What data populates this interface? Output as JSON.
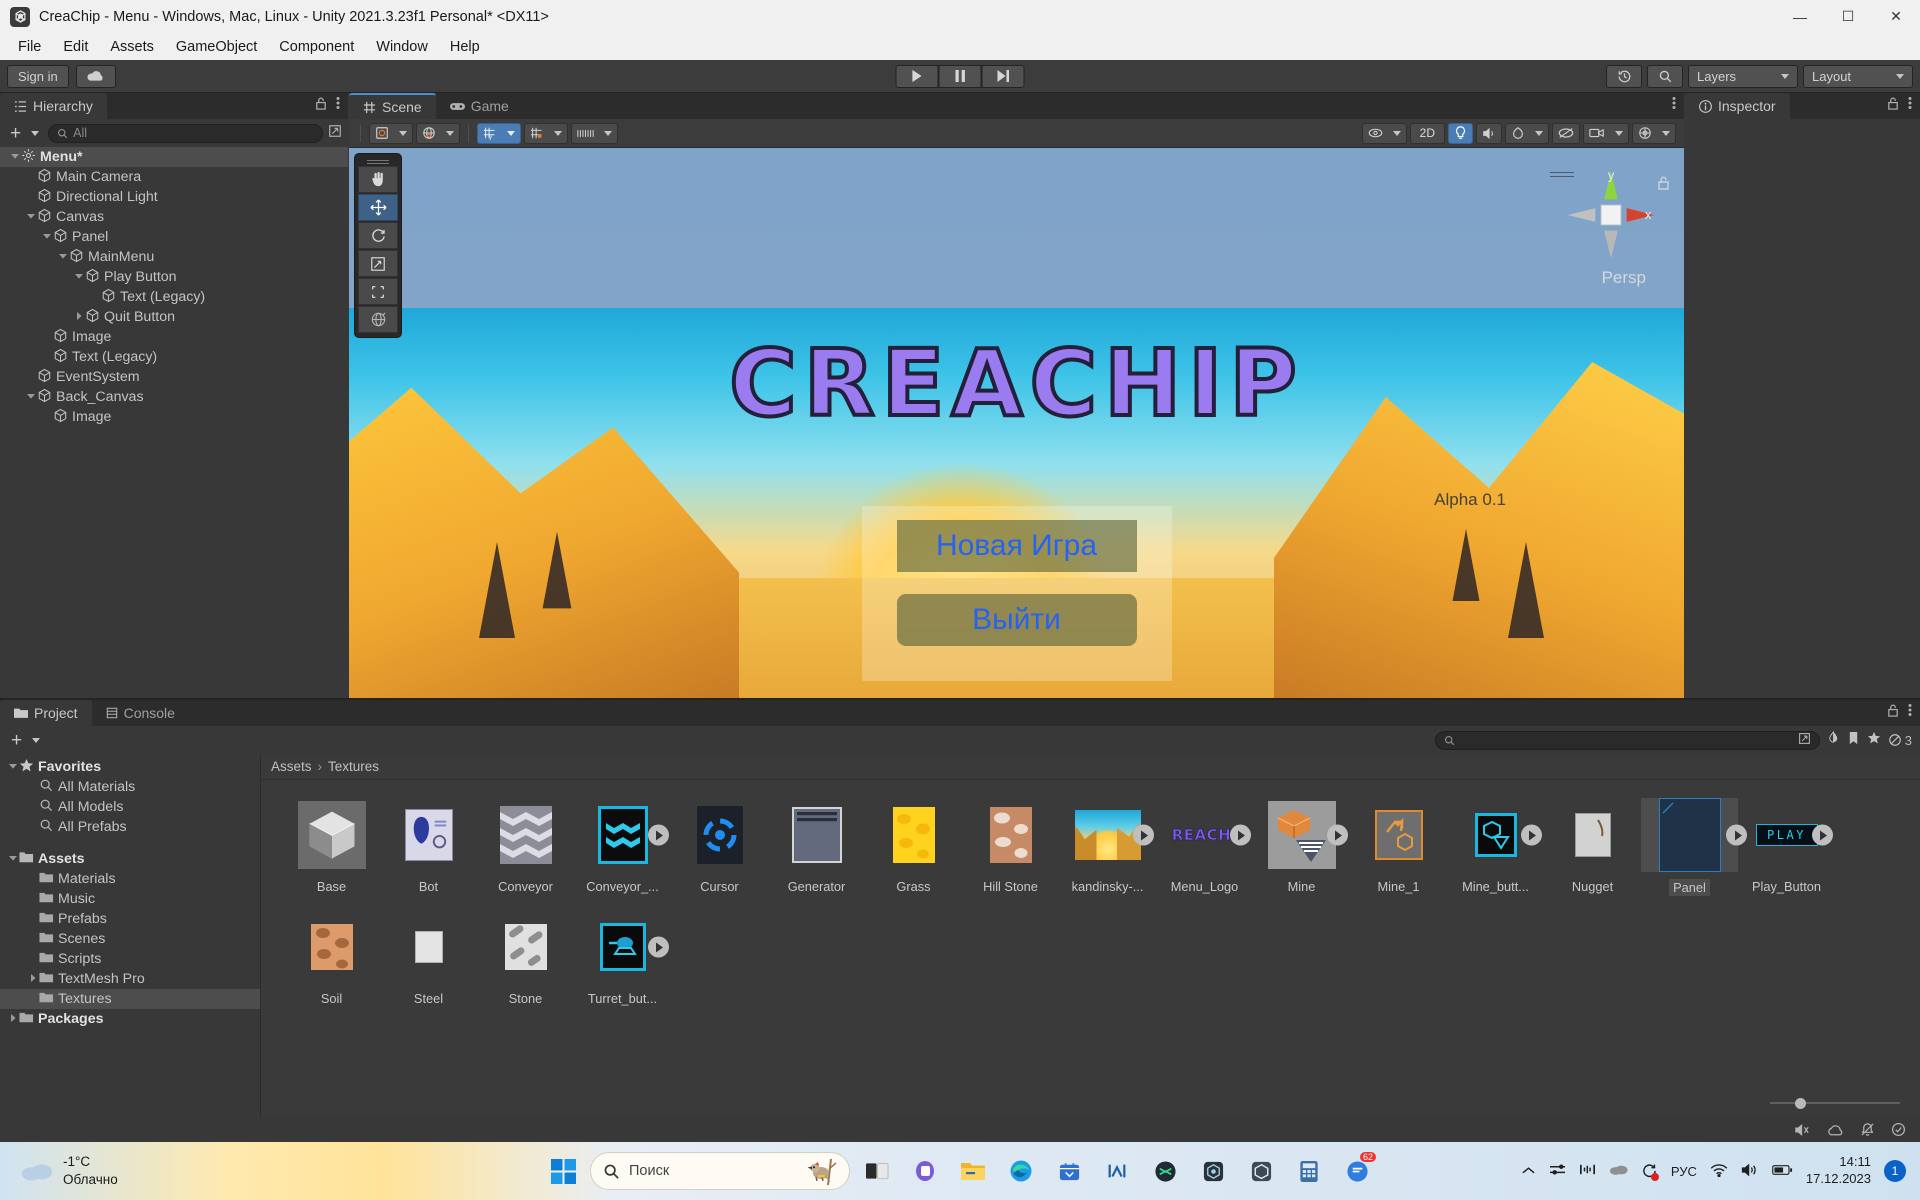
{
  "window": {
    "title": "CreaChip - Menu - Windows, Mac, Linux - Unity 2021.3.23f1 Personal* <DX11>",
    "minimize": "—",
    "maximize": "☐",
    "close": "✕"
  },
  "menubar": {
    "items": [
      "File",
      "Edit",
      "Assets",
      "GameObject",
      "Component",
      "Window",
      "Help"
    ]
  },
  "toolbar": {
    "signin": "Sign in",
    "cloud_icon": "cloud-icon",
    "play": "play-icon",
    "pause": "pause-icon",
    "step": "step-icon",
    "history_icon": "history-icon",
    "search_icon": "search-icon",
    "layers": "Layers",
    "layout": "Layout"
  },
  "hierarchy": {
    "tab": "Hierarchy",
    "search_placeholder": "All",
    "items": [
      {
        "label": "Menu*",
        "depth": 0,
        "arrow": "down",
        "selected": true,
        "icon": "scene-icon",
        "bold": true
      },
      {
        "label": "Main Camera",
        "depth": 1,
        "arrow": "none",
        "icon": "gameobject-icon"
      },
      {
        "label": "Directional Light",
        "depth": 1,
        "arrow": "none",
        "icon": "gameobject-icon"
      },
      {
        "label": "Canvas",
        "depth": 1,
        "arrow": "down",
        "icon": "gameobject-icon"
      },
      {
        "label": "Panel",
        "depth": 2,
        "arrow": "down",
        "icon": "gameobject-icon"
      },
      {
        "label": "MainMenu",
        "depth": 3,
        "arrow": "down",
        "icon": "gameobject-icon"
      },
      {
        "label": "Play Button",
        "depth": 4,
        "arrow": "down",
        "icon": "gameobject-icon"
      },
      {
        "label": "Text (Legacy)",
        "depth": 5,
        "arrow": "none",
        "icon": "gameobject-icon"
      },
      {
        "label": "Quit Button",
        "depth": 4,
        "arrow": "right",
        "icon": "gameobject-icon"
      },
      {
        "label": "Image",
        "depth": 2,
        "arrow": "none",
        "icon": "gameobject-icon"
      },
      {
        "label": "Text (Legacy)",
        "depth": 2,
        "arrow": "none",
        "icon": "gameobject-icon"
      },
      {
        "label": "EventSystem",
        "depth": 1,
        "arrow": "none",
        "icon": "gameobject-icon"
      },
      {
        "label": "Back_Canvas",
        "depth": 1,
        "arrow": "down",
        "icon": "gameobject-icon"
      },
      {
        "label": "Image",
        "depth": 2,
        "arrow": "none",
        "icon": "gameobject-icon"
      }
    ]
  },
  "scene": {
    "tabs": [
      {
        "label": "Scene",
        "icon": "grid-icon",
        "active": true
      },
      {
        "label": "Game",
        "icon": "gamepad-icon",
        "active": false
      }
    ],
    "tools": [
      "hand-tool",
      "move-tool",
      "rotate-tool",
      "scale-tool",
      "rect-tool",
      "transform-tool"
    ],
    "active_tool": "move-tool",
    "gizmo": {
      "axis_y": "y",
      "axis_x": "x",
      "projection": "Persp"
    },
    "game": {
      "logo": "CREACHIP",
      "alpha": "Alpha 0.1",
      "buttons": [
        "Новая Игра",
        "Выйти"
      ]
    }
  },
  "inspector": {
    "tab": "Inspector"
  },
  "project": {
    "tabs": [
      {
        "label": "Project",
        "active": true
      },
      {
        "label": "Console",
        "active": false
      }
    ],
    "search_placeholder": "",
    "hidden_count": "3",
    "breadcrumb": [
      "Assets",
      "Textures"
    ],
    "tree": [
      {
        "label": "Favorites",
        "depth": 0,
        "arrow": "down",
        "icon": "star-icon",
        "bold": true
      },
      {
        "label": "All Materials",
        "depth": 1,
        "arrow": "none",
        "icon": "search-icon"
      },
      {
        "label": "All Models",
        "depth": 1,
        "arrow": "none",
        "icon": "search-icon"
      },
      {
        "label": "All Prefabs",
        "depth": 1,
        "arrow": "none",
        "icon": "search-icon"
      },
      {
        "label": "",
        "depth": 0,
        "arrow": "none",
        "icon": "spacer"
      },
      {
        "label": "Assets",
        "depth": 0,
        "arrow": "down",
        "icon": "folder-open-icon",
        "bold": true
      },
      {
        "label": "Materials",
        "depth": 1,
        "arrow": "none",
        "icon": "folder-icon"
      },
      {
        "label": "Music",
        "depth": 1,
        "arrow": "none",
        "icon": "folder-icon"
      },
      {
        "label": "Prefabs",
        "depth": 1,
        "arrow": "none",
        "icon": "folder-icon"
      },
      {
        "label": "Scenes",
        "depth": 1,
        "arrow": "none",
        "icon": "folder-icon"
      },
      {
        "label": "Scripts",
        "depth": 1,
        "arrow": "none",
        "icon": "folder-icon"
      },
      {
        "label": "TextMesh Pro",
        "depth": 1,
        "arrow": "right",
        "icon": "folder-icon"
      },
      {
        "label": "Textures",
        "depth": 1,
        "arrow": "none",
        "icon": "folder-icon",
        "selected": true
      },
      {
        "label": "Packages",
        "depth": 0,
        "arrow": "right",
        "icon": "folder-icon",
        "bold": true
      }
    ],
    "assets": [
      {
        "name": "Base",
        "kind": "model-cube",
        "badge": false
      },
      {
        "name": "Bot",
        "kind": "sprite-bot",
        "badge": false
      },
      {
        "name": "Conveyor",
        "kind": "tex-conveyor",
        "badge": false
      },
      {
        "name": "Conveyor_...",
        "kind": "prefab-conveyor",
        "badge": true
      },
      {
        "name": "Cursor",
        "kind": "tex-cursor",
        "badge": false
      },
      {
        "name": "Generator",
        "kind": "tex-generator",
        "badge": false
      },
      {
        "name": "Grass",
        "kind": "tex-grass",
        "badge": false
      },
      {
        "name": "Hill Stone",
        "kind": "tex-hillstone",
        "badge": false
      },
      {
        "name": "kandinsky-...",
        "kind": "tex-kandinsky",
        "badge": true
      },
      {
        "name": "Menu_Logo",
        "kind": "tex-menulogo",
        "badge": true
      },
      {
        "name": "Mine",
        "kind": "prefab-mine",
        "badge": true
      },
      {
        "name": "Mine_1",
        "kind": "prefab-mine1",
        "badge": false
      },
      {
        "name": "Mine_butt...",
        "kind": "prefab-minebutton",
        "badge": true
      },
      {
        "name": "Nugget",
        "kind": "tex-nugget",
        "badge": false
      },
      {
        "name": "Panel",
        "kind": "tex-panel",
        "badge": true,
        "selected": true
      },
      {
        "name": "Play_Button",
        "kind": "tex-playbutton",
        "badge": true
      },
      {
        "name": "Soil",
        "kind": "tex-soil",
        "badge": false
      },
      {
        "name": "Steel",
        "kind": "tex-steel",
        "badge": false
      },
      {
        "name": "Stone",
        "kind": "tex-stone",
        "badge": false
      },
      {
        "name": "Turret_but...",
        "kind": "prefab-turret",
        "badge": true
      }
    ]
  },
  "taskbar": {
    "weather": {
      "temp": "-1°C",
      "desc": "Облачно",
      "icon": "cloud-icon"
    },
    "start_icon": "windows-start-icon",
    "search_placeholder": "Поиск",
    "apps": [
      "taskview-icon",
      "teams-icon",
      "explorer-icon",
      "edge-icon",
      "store-icon",
      "app-m-icon",
      "app-green-icon",
      "app-unityhub-icon",
      "app-unity-icon",
      "app-calc-icon",
      "app-chat-icon"
    ],
    "chat_badge": "62",
    "tray": {
      "chevron": "chevron-up-icon",
      "settings_icon": "sliders-icon",
      "meter_icon": "meter-icon",
      "cloud_icon": "cloud-sync-icon",
      "refresh_icon": "refresh-dot-icon",
      "language": "РУС",
      "wifi_icon": "wifi-icon",
      "volume_icon": "volume-icon",
      "battery_icon": "battery-icon",
      "time": "14:11",
      "date": "17.12.2023",
      "notification_count": "1"
    }
  }
}
